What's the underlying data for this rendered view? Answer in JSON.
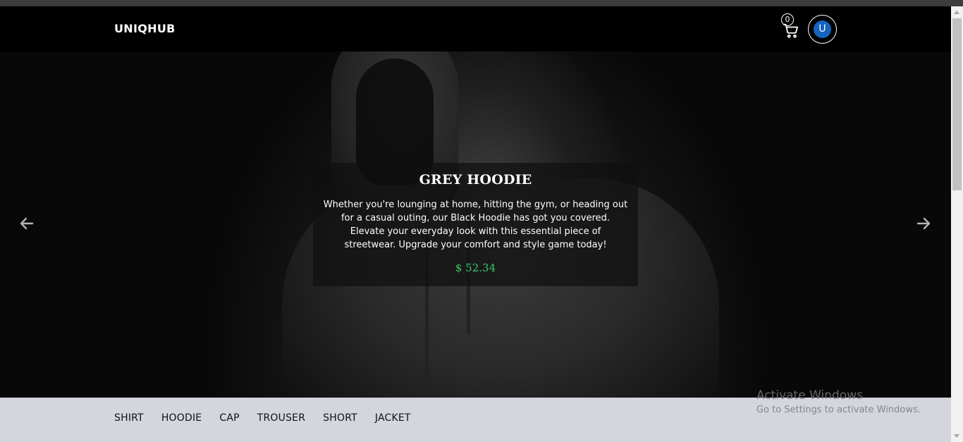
{
  "navbar": {
    "brand": "UNIQHUB",
    "cart_count": "0",
    "cart_icon": "cart-icon",
    "avatar_initial": "U",
    "avatar_color": "#1565c0"
  },
  "hero": {
    "title": "GREY HOODIE",
    "description": "Whether you're lounging at home, hitting the gym, or heading out for a casual outing, our Black Hoodie has got you covered. Elevate your everyday look with this essential piece of streetwear. Upgrade your comfort and style game today!",
    "price": "$ 52.34",
    "price_color": "#3cc66e",
    "prev_icon": "arrow-left-icon",
    "next_icon": "arrow-right-icon"
  },
  "categories": [
    "SHIRT",
    "HOODIE",
    "CAP",
    "TROUSER",
    "SHORT",
    "JACKET"
  ],
  "watermark": {
    "title": "Activate Windows",
    "subtitle": "Go to Settings to activate Windows."
  }
}
